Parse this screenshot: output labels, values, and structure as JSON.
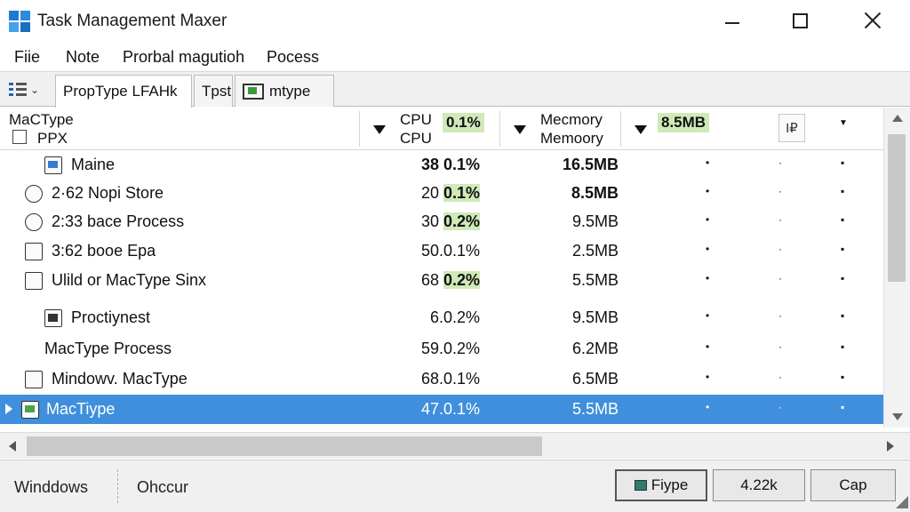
{
  "window": {
    "title": "Task Management Maxer",
    "controls": [
      "minimize",
      "maximize",
      "close"
    ]
  },
  "menu": {
    "items": [
      "Fiie",
      "Note",
      "Prorbal magutioh",
      "Pocess"
    ]
  },
  "tabs": [
    {
      "label": "PropType LFAHk"
    },
    {
      "label": "Tpst"
    },
    {
      "label": "mtype"
    }
  ],
  "header": {
    "name_line1": "MaCType",
    "name_line2": "PPX",
    "cpu_line1": "CPU",
    "cpu_line2": "CPU",
    "cpu_total": "0.1%",
    "mem_line1": "Mecmory",
    "mem_line2": "Memoory",
    "mem_total": "8.5MB",
    "pin_label": "I₽"
  },
  "processes": [
    {
      "name": "Maine",
      "cpu_prefix": "38",
      "cpu_value": "0.1%",
      "cpu_bold": true,
      "cpu_highlight": false,
      "memory": "16.5MB",
      "mem_bold": true,
      "icon": "chart-app-icon",
      "indent": 1,
      "selected": false
    },
    {
      "name": "2·62 Nopi Store",
      "cpu_prefix": "20",
      "cpu_value": "0.1%",
      "cpu_bold": false,
      "cpu_highlight": true,
      "memory": "8.5MB",
      "mem_bold": true,
      "icon": "clock-icon",
      "indent": 0,
      "selected": false
    },
    {
      "name": "2:33 bace Process",
      "cpu_prefix": "30",
      "cpu_value": "0.2%",
      "cpu_bold": false,
      "cpu_highlight": true,
      "memory": "9.5MB",
      "mem_bold": false,
      "icon": "cloud-icon",
      "indent": 0,
      "selected": false
    },
    {
      "name": "3:62 booe Epa",
      "cpu_prefix": "50.",
      "cpu_value": "0.1%",
      "cpu_bold": false,
      "cpu_highlight": false,
      "memory": "2.5MB",
      "mem_bold": false,
      "icon": "window-icon",
      "indent": 0,
      "selected": false
    },
    {
      "name": "Ulild or MacType Sinx",
      "cpu_prefix": "68",
      "cpu_value": "0.2%",
      "cpu_bold": false,
      "cpu_highlight": true,
      "memory": "5.5MB",
      "mem_bold": false,
      "icon": "blank-window-icon",
      "indent": 0,
      "selected": false
    },
    {
      "name": "Proctiynest",
      "cpu_prefix": "6.",
      "cpu_value": "0.2%",
      "cpu_bold": false,
      "cpu_highlight": false,
      "memory": "9.5MB",
      "mem_bold": false,
      "icon": "dark-chart-icon",
      "indent": 1,
      "selected": false
    },
    {
      "name": "MacType Process",
      "cpu_prefix": "59.",
      "cpu_value": "0.2%",
      "cpu_bold": false,
      "cpu_highlight": false,
      "memory": "6.2MB",
      "mem_bold": false,
      "icon": "",
      "indent": 1,
      "selected": false
    },
    {
      "name": "Mindowv. MacType",
      "cpu_prefix": "68.",
      "cpu_value": "0.1%",
      "cpu_bold": false,
      "cpu_highlight": false,
      "memory": "6.5MB",
      "mem_bold": false,
      "icon": "subitem-icon",
      "indent": 0,
      "selected": false
    },
    {
      "name": "MacTiype",
      "cpu_prefix": "47.",
      "cpu_value": "0.1%",
      "cpu_bold": false,
      "cpu_highlight": false,
      "memory": "5.5MB",
      "mem_bold": false,
      "icon": "green-chart-icon",
      "indent": 0,
      "selected": true
    }
  ],
  "status": {
    "left_label": "Winddows",
    "mid_label": "Ohccur",
    "buttons": [
      "Fiype",
      "4.22k",
      "Cap"
    ]
  },
  "colors": {
    "selection": "#3f8fdc",
    "highlight": "#cfe9b9",
    "accent": "#1f7ad1"
  }
}
